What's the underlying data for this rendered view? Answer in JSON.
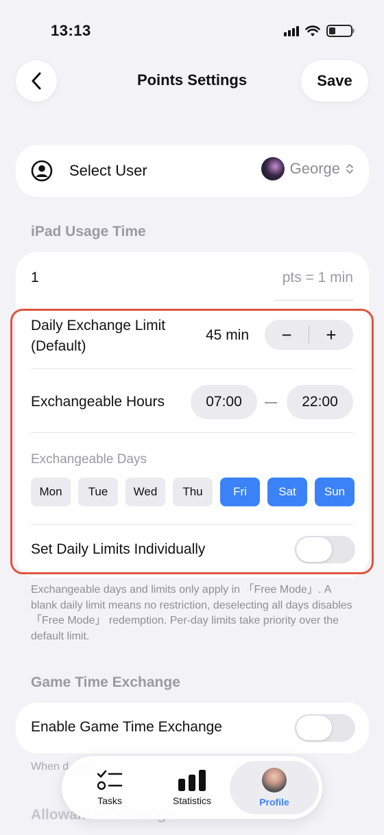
{
  "status_bar": {
    "time": "13:13"
  },
  "header": {
    "title": "Points Settings",
    "save_label": "Save"
  },
  "user_select": {
    "label": "Select User",
    "user_name": "George"
  },
  "ipad_section": {
    "title": "iPad Usage Time",
    "points_value": "1",
    "points_unit": "pts = 1 min",
    "daily_limit_label_line1": "Daily Exchange Limit",
    "daily_limit_label_line2": "(Default)",
    "daily_limit_value": "45 min",
    "decrement_label": "−",
    "increment_label": "+",
    "hours_label": "Exchangeable Hours",
    "start_time": "07:00",
    "end_time": "22:00",
    "days_label": "Exchangeable Days",
    "days": [
      {
        "label": "Mon",
        "selected": false
      },
      {
        "label": "Tue",
        "selected": false
      },
      {
        "label": "Wed",
        "selected": false
      },
      {
        "label": "Thu",
        "selected": false
      },
      {
        "label": "Fri",
        "selected": true
      },
      {
        "label": "Sat",
        "selected": true
      },
      {
        "label": "Sun",
        "selected": true
      }
    ],
    "individual_limits_label": "Set Daily Limits Individually",
    "individual_limits_on": false
  },
  "footnote": "Exchangeable days and limits only apply in 「Free Mode」. A blank daily limit means no restriction, deselecting all days disables 「Free Mode」 redemption. Per-day limits take priority over the default limit.",
  "game_section": {
    "title": "Game Time Exchange",
    "enable_label": "Enable Game Time Exchange",
    "enabled": false,
    "note_partial": "When                                                  d statis"
  },
  "allowance_section": {
    "title": "Allowance Exchange"
  },
  "tabbar": {
    "tabs": [
      {
        "label": "Tasks",
        "icon": "tasks-icon"
      },
      {
        "label": "Statistics",
        "icon": "bar-chart-icon"
      },
      {
        "label": "Profile",
        "icon": "profile-avatar"
      }
    ],
    "active": "Profile"
  },
  "colors": {
    "accent": "#3b82f6",
    "highlight_border": "#e0533f",
    "background": "#f2f2f7"
  }
}
